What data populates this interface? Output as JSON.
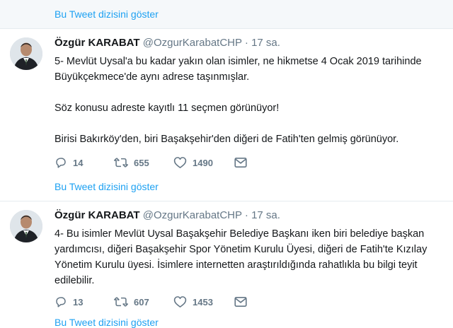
{
  "thread_link": {
    "label": "Bu Tweet dizisini göster"
  },
  "tweets": [
    {
      "name": "Özgür KARABAT",
      "handle": "@OzgurKarabatCHP",
      "dot": "·",
      "time": "17 sa.",
      "lines": [
        "5- Mevlüt Uysal'a bu kadar yakın olan isimler, ne hikmetse 4 Ocak 2019 tarihinde",
        "Büyükçekmece'de aynı adrese taşınmışlar.",
        "",
        "Söz konusu adreste kayıtlı 11 seçmen görünüyor!",
        "",
        "Birisi Bakırköy'den, biri Başakşehir'den diğeri de Fatih'ten gelmiş görünüyor."
      ],
      "replies": "14",
      "retweets": "655",
      "likes": "1490"
    },
    {
      "name": "Özgür KARABAT",
      "handle": "@OzgurKarabatCHP",
      "dot": "·",
      "time": "17 sa.",
      "lines": [
        "4- Bu isimler Mevlüt Uysal Başakşehir Belediye Başkanı iken biri belediye başkan",
        "yardımcısı, diğeri Başakşehir Spor Yönetim Kurulu Üyesi, diğeri de Fatih'te Kızılay",
        "Yönetim Kurulu üyesi. İsimlere internetten araştırıldığında rahatlıkla bu bilgi teyit",
        "edilebilir."
      ],
      "replies": "13",
      "retweets": "607",
      "likes": "1453"
    }
  ],
  "icons": [
    "reply-icon",
    "retweet-icon",
    "like-icon",
    "message-icon"
  ],
  "colors": {
    "link": "#1da1f2",
    "muted": "#657786",
    "text": "#14171a",
    "divider": "#e6ecf0"
  }
}
